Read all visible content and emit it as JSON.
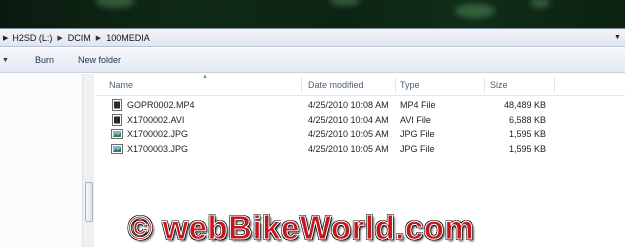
{
  "address_bar": {
    "crumbs": [
      "H2SD (L:)",
      "DCIM",
      "100MEDIA"
    ]
  },
  "toolbar": {
    "burn_label": "Burn",
    "new_folder_label": "New folder"
  },
  "columns": {
    "name": "Name",
    "date_modified": "Date modified",
    "type": "Type",
    "size": "Size"
  },
  "files": [
    {
      "name": "GOPR0002.MP4",
      "date": "4/25/2010 10:08 AM",
      "type": "MP4 File",
      "size": "48,489 KB",
      "icon": "video-file-icon"
    },
    {
      "name": "X1700002.AVI",
      "date": "4/25/2010 10:04 AM",
      "type": "AVI File",
      "size": "6,588 KB",
      "icon": "video-file-icon"
    },
    {
      "name": "X1700002.JPG",
      "date": "4/25/2010 10:05 AM",
      "type": "JPG File",
      "size": "1,595 KB",
      "icon": "image-file-icon"
    },
    {
      "name": "X1700003.JPG",
      "date": "4/25/2010 10:05 AM",
      "type": "JPG File",
      "size": "1,595 KB",
      "icon": "image-file-icon"
    }
  ],
  "watermark": {
    "text": "© webBikeWorld.com"
  },
  "colors": {
    "watermark_red": "#c4161c",
    "header_text": "#4c607a"
  }
}
